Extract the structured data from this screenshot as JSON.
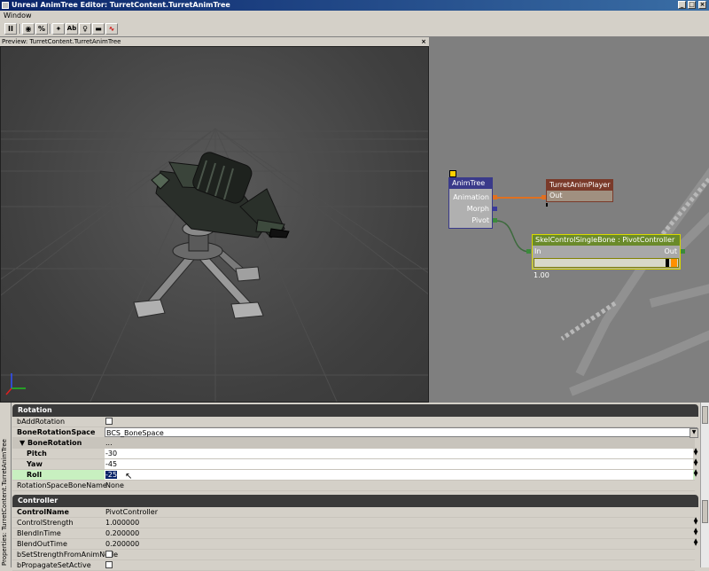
{
  "window": {
    "title": "Unreal AnimTree Editor: TurretContent.TurretAnimTree",
    "minimize": "_",
    "maximize": "□",
    "close": "×"
  },
  "menu": {
    "window_label": "Window"
  },
  "toolbar": {
    "buttons": [
      {
        "icon": "pause-icon",
        "glyph": "II"
      },
      {
        "icon": "eye-icon",
        "glyph": "◉"
      },
      {
        "icon": "percent-icon",
        "glyph": "%"
      },
      {
        "icon": "running-man-icon",
        "glyph": "✦"
      },
      {
        "icon": "text-ab-icon",
        "glyph": "Ab"
      },
      {
        "icon": "lightbulb-icon",
        "glyph": "♀"
      },
      {
        "icon": "bar-icon",
        "glyph": "▬"
      },
      {
        "icon": "curve-icon",
        "glyph": "∿"
      }
    ]
  },
  "preview": {
    "header": "Preview: TurretContent.TurretAnimTree",
    "close_glyph": "×"
  },
  "graph": {
    "animtree": {
      "title": "AnimTree",
      "inputs": [
        "Animation",
        "Morph",
        "Pivot"
      ]
    },
    "player": {
      "title": "TurretAnimPlayer",
      "out": "Out"
    },
    "skelcontrol": {
      "title": "SkelControlSingleBone : PivotController",
      "in": "In",
      "out": "Out",
      "strength": "1.00"
    },
    "colors": {
      "animtree": "#3a3a8a",
      "player": "#7a3a2a",
      "skel": "#6a8a2a",
      "wire_anim": "#e07020",
      "wire_pivot": "#3c6a3c"
    }
  },
  "properties": {
    "side_tab": "Properties: TurretContent.TurretAnimTree",
    "rotation_section": "Rotation",
    "rotation_rows": [
      {
        "key": "bAddRotation",
        "bold": false,
        "value": "",
        "checkbox": true
      },
      {
        "key": "BoneRotationSpace",
        "bold": true,
        "value": "BCS_BoneSpace",
        "dropdown": true
      },
      {
        "key": "▼ BoneRotation",
        "bold": true,
        "value": "...",
        "group": true
      },
      {
        "key": "Pitch",
        "bold": true,
        "value": "-30",
        "indent": true
      },
      {
        "key": "Yaw",
        "bold": true,
        "value": "-45",
        "indent": true
      },
      {
        "key": "Roll",
        "bold": true,
        "value": "-25",
        "indent": true,
        "selected": true
      },
      {
        "key": "RotationSpaceBoneName",
        "bold": false,
        "value": "None"
      }
    ],
    "controller_section": "Controller",
    "controller_rows": [
      {
        "key": "ControlName",
        "bold": true,
        "value": "PivotController"
      },
      {
        "key": "ControlStrength",
        "bold": false,
        "value": "1.000000"
      },
      {
        "key": "BlendInTime",
        "bold": false,
        "value": "0.200000"
      },
      {
        "key": "BlendOutTime",
        "bold": false,
        "value": "0.200000"
      },
      {
        "key": "bSetStrengthFromAnimNode",
        "bold": false,
        "value": "",
        "checkbox": true
      },
      {
        "key": "bPropagateSetActive",
        "bold": false,
        "value": "",
        "checkbox": true
      }
    ]
  }
}
